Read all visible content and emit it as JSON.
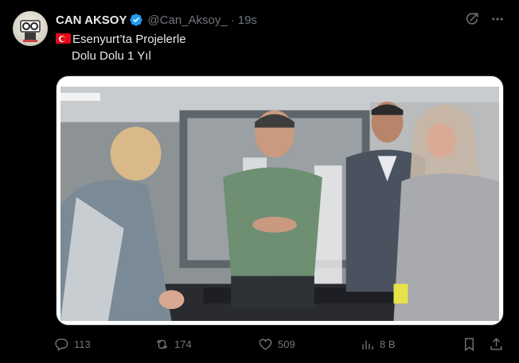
{
  "tweet": {
    "author_name": "CAN AKSOY",
    "handle": "@Can_Aksoy_",
    "separator": "·",
    "time": "19s",
    "text_line1": "Esenyurt’ta Projelerle",
    "text_line2": "Dolu Dolu 1 Yıl"
  },
  "actions": {
    "replies": "113",
    "reposts": "174",
    "likes": "509",
    "views": "8 B"
  },
  "icons": {
    "verified": "verified-badge-icon",
    "grok": "grok-icon",
    "more": "more-icon",
    "reply": "reply-icon",
    "repost": "repost-icon",
    "like": "heart-icon",
    "views": "views-icon",
    "bookmark": "bookmark-icon",
    "share": "share-icon"
  },
  "colors": {
    "background": "#000000",
    "text": "#e7e9ea",
    "muted": "#71767b",
    "verified": "#1d9bf0",
    "flag": "#e30a17"
  }
}
